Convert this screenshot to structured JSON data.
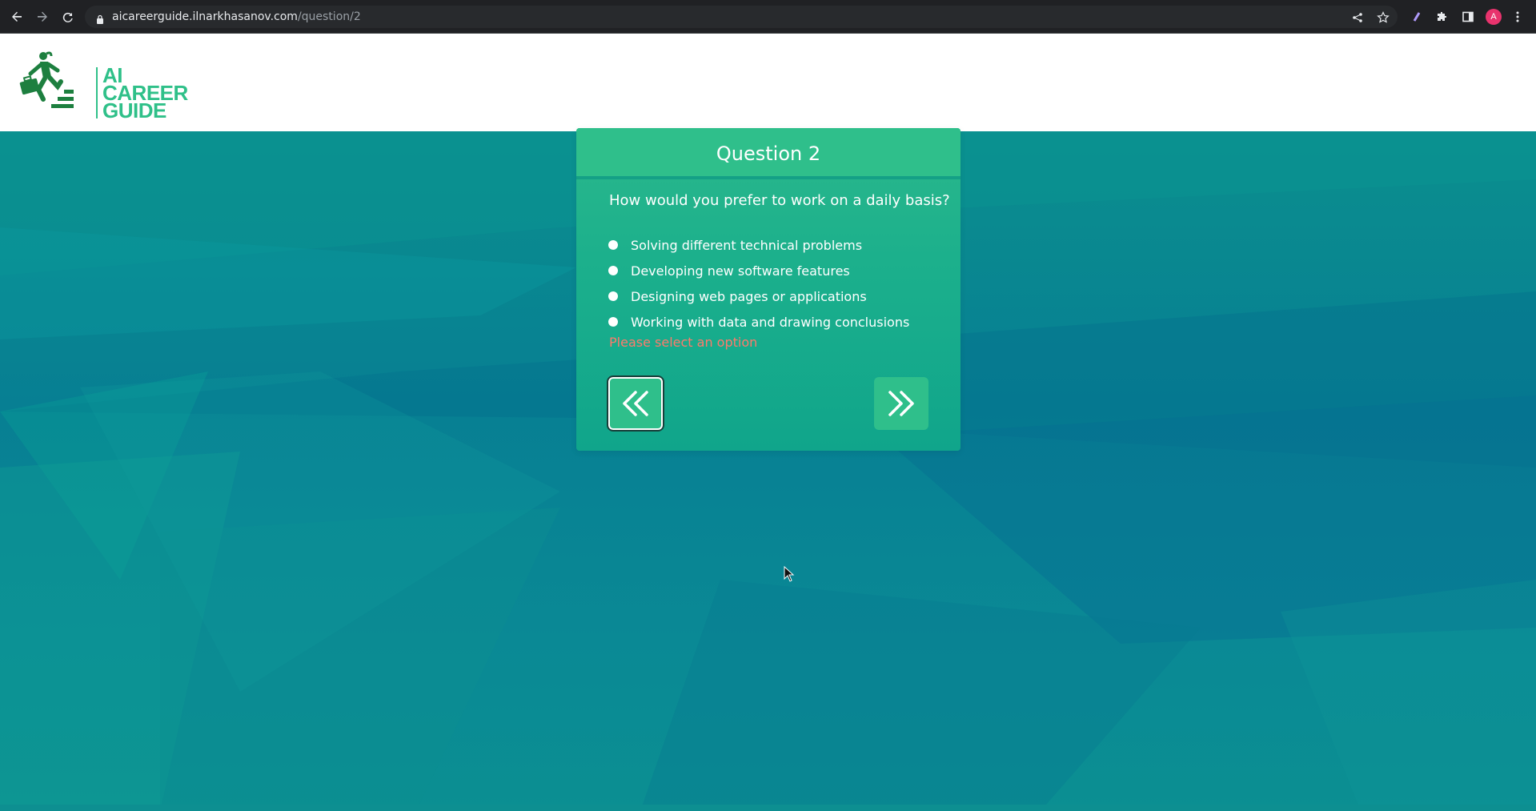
{
  "browser": {
    "url_host": "aicareerguide.ilnarkhasanov.com",
    "url_path": "/question/2",
    "avatar_letter": "A",
    "icons": [
      "back-arrow-icon",
      "forward-arrow-icon",
      "reload-icon",
      "lock-icon",
      "share-icon",
      "star-icon",
      "extension-icon",
      "puzzle-icon",
      "sidebar-icon",
      "menu-dots-icon"
    ]
  },
  "header": {
    "logo_lines": [
      "AI",
      "CAREER",
      "GUIDE"
    ],
    "brand_color": "#2fc089"
  },
  "quiz": {
    "title": "Question 2",
    "question": "How would you prefer to work on a daily basis?",
    "options": [
      "Solving different technical problems",
      "Developing new software features",
      "Designing web pages or applications",
      "Working with data and drawing conclusions"
    ],
    "error": "Please select an option",
    "error_color": "#ff7a6b",
    "prev_icon": "double-chevron-left-icon",
    "next_icon": "double-chevron-right-icon"
  }
}
